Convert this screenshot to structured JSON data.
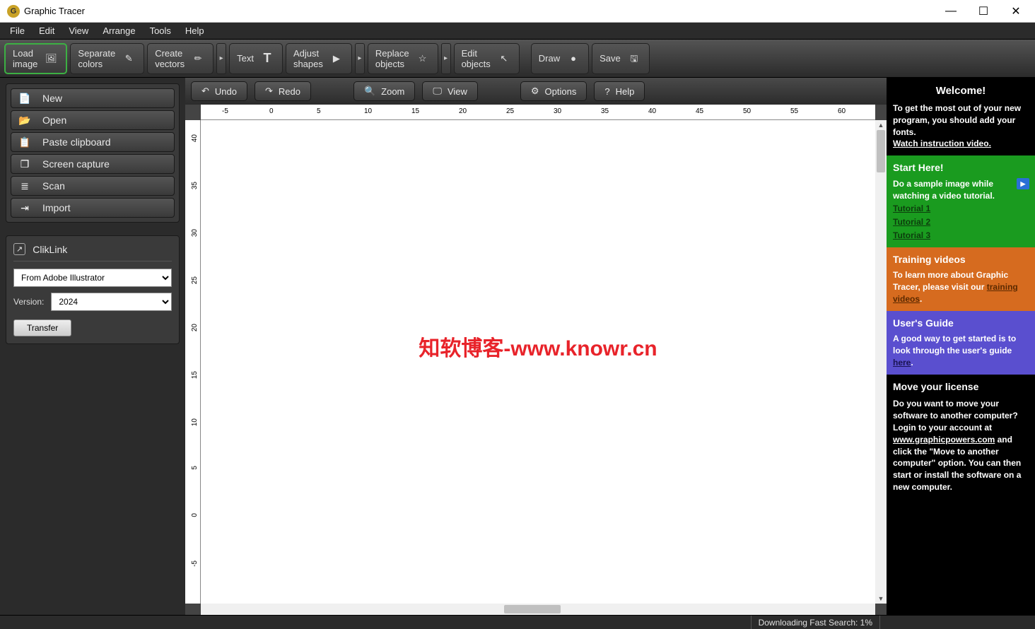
{
  "window": {
    "title": "Graphic Tracer"
  },
  "menu": {
    "file": "File",
    "edit": "Edit",
    "view": "View",
    "arrange": "Arrange",
    "tools": "Tools",
    "help": "Help"
  },
  "toolbar": {
    "load": "Load\nimage",
    "separate": "Separate\ncolors",
    "create": "Create\nvectors",
    "text": "Text",
    "adjust": "Adjust\nshapes",
    "replace": "Replace\nobjects",
    "editobj": "Edit\nobjects",
    "draw": "Draw",
    "save": "Save"
  },
  "sec": {
    "undo": "Undo",
    "redo": "Redo",
    "zoom": "Zoom",
    "view": "View",
    "options": "Options",
    "help": "Help"
  },
  "side": {
    "new": "New",
    "open": "Open",
    "paste": "Paste clipboard",
    "capture": "Screen capture",
    "scan": "Scan",
    "import": "Import"
  },
  "cliklink": {
    "title": "ClikLink",
    "from": "From Adobe Illustrator",
    "version_label": "Version:",
    "version": "2024",
    "transfer": "Transfer"
  },
  "ruler": {
    "h": [
      "-5",
      "0",
      "5",
      "10",
      "15",
      "20",
      "25",
      "30",
      "35",
      "40",
      "45",
      "50",
      "55",
      "60"
    ],
    "v": [
      "40",
      "35",
      "30",
      "25",
      "20",
      "15",
      "10",
      "5",
      "0",
      "-5"
    ]
  },
  "watermark": "知软博客-www.knowr.cn",
  "right": {
    "welcome": {
      "title": "Welcome!",
      "text1": "To get the most out of your new program, you should add your fonts.",
      "link": "Watch instruction video."
    },
    "start": {
      "title": "Start Here!",
      "text": "Do a sample image while watching a video tutorial.",
      "t1": "Tutorial 1",
      "t2": "Tutorial 2",
      "t3": "Tutorial 3"
    },
    "train": {
      "title": "Training videos",
      "text1": "To learn more about Graphic Tracer, please visit our ",
      "link": "training videos",
      "text2": "."
    },
    "guide": {
      "title": "User's Guide",
      "text1": "A good way to get started is to look through the user's guide ",
      "link": "here",
      "text2": "."
    },
    "move": {
      "title": "Move your license",
      "text1": "Do you want to move your software to another computer? Login to your account at ",
      "link": "www.graphicpowers.com",
      "text2": " and click the \"Move to another computer\" option. You can then start or install the software on a new computer."
    }
  },
  "status": {
    "download": "Downloading Fast Search: 1%"
  }
}
